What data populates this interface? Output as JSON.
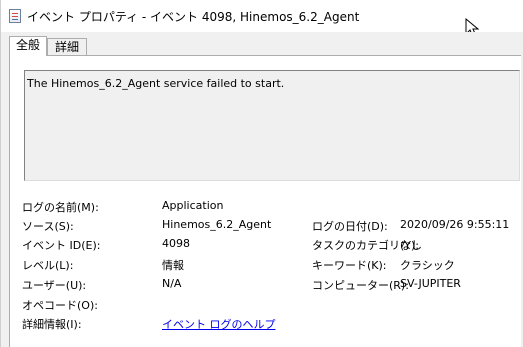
{
  "window": {
    "title": "イベント プロパティ - イベント 4098, Hinemos_6.2_Agent"
  },
  "tabs": [
    {
      "label": "全般",
      "active": true
    },
    {
      "label": "詳細",
      "active": false
    }
  ],
  "description": "The Hinemos_6.2_Agent service failed to start.",
  "fields": {
    "log_name": {
      "label": "ログの名前(M):",
      "value": "Application"
    },
    "source": {
      "label": "ソース(S):",
      "value": "Hinemos_6.2_Agent"
    },
    "logged": {
      "label": "ログの日付(D):",
      "value": "2020/09/26 9:55:11"
    },
    "event_id": {
      "label": "イベント ID(E):",
      "value": "4098"
    },
    "task_category": {
      "label": "タスクのカテゴリ(Y):",
      "value": "なし"
    },
    "level": {
      "label": "レベル(L):",
      "value": "情報"
    },
    "keywords": {
      "label": "キーワード(K):",
      "value": "クラシック"
    },
    "user": {
      "label": "ユーザー(U):",
      "value": "N/A"
    },
    "computer": {
      "label": "コンピューター(R):",
      "value": "SV-JUPITER"
    },
    "opcode": {
      "label": "オペコード(O):",
      "value": ""
    },
    "more_info": {
      "label": "詳細情報(I):",
      "value": "イベント ログのヘルプ"
    }
  },
  "icons": {
    "window": "event-properties-icon",
    "cursor": "mouse-pointer-icon"
  }
}
